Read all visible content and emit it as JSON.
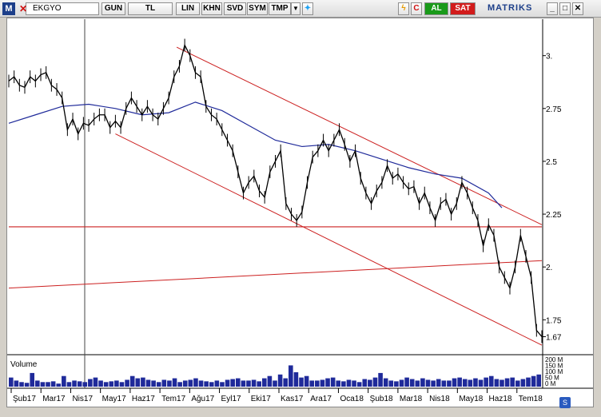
{
  "toolbar": {
    "logo": "M",
    "symbol": "EKGYO",
    "buttons": [
      "GUN",
      "TL",
      "LIN",
      "KHN",
      "SVD",
      "SYM",
      "TMP"
    ],
    "buy": "AL",
    "sell": "SAT",
    "brand": "MATRIKS",
    "colors": {
      "buy": "#1a9a1a",
      "sell": "#d21c1c",
      "brand": "#1d3f8a"
    }
  },
  "volume_panel": {
    "title": "Volume",
    "ticks": [
      "200 M",
      "150 M",
      "100 M",
      "50 M",
      "0 M"
    ]
  },
  "chart_data": {
    "type": "line",
    "title": "",
    "series_colors": {
      "price": "#000000",
      "moving_average": "#1f2a9a",
      "trendlines": "#cc2020"
    },
    "yaxis": {
      "ticks": [
        3.0,
        2.75,
        2.5,
        2.25,
        2.0,
        1.75,
        1.67
      ],
      "tick_labels": [
        "3.",
        "2.75",
        "2.5",
        "2.25",
        "2.",
        "1.75",
        "1.67"
      ],
      "ylim": [
        1.6,
        3.15
      ]
    },
    "xaxis": {
      "tick_labels": [
        "Şub17",
        "Mar17",
        "Nis17",
        "May17",
        "Haz17",
        "Tem17",
        "Ağu17",
        "Eyl17",
        "Eki17",
        "Kas17",
        "Ara17",
        "Oca18",
        "Şub18",
        "Mar18",
        "Nis18",
        "May18",
        "Haz18",
        "Tem18"
      ]
    },
    "price": {
      "name": "",
      "x": [
        0,
        2,
        4,
        6,
        8,
        10,
        12,
        14,
        16,
        18,
        20,
        22,
        24,
        26,
        28,
        30,
        32,
        34,
        36,
        38,
        40,
        42,
        44,
        46,
        48,
        50,
        52,
        54,
        56,
        58,
        60,
        62,
        64,
        66,
        68,
        70,
        72,
        74,
        76,
        78,
        80,
        82,
        84,
        86,
        88,
        90,
        92,
        94,
        96,
        98,
        100,
        102,
        104,
        106,
        108,
        110,
        112,
        114,
        116,
        118,
        120,
        122,
        124,
        126,
        128,
        130,
        132,
        134,
        136,
        138,
        140,
        142,
        144,
        146,
        148,
        150,
        152,
        154,
        156,
        158,
        160,
        162,
        164,
        166,
        168,
        170,
        172,
        174,
        176,
        178,
        180,
        182,
        184,
        186,
        188,
        190,
        192,
        194,
        196,
        198,
        200
      ],
      "values": [
        2.88,
        2.9,
        2.86,
        2.85,
        2.9,
        2.88,
        2.91,
        2.92,
        2.86,
        2.84,
        2.8,
        2.65,
        2.7,
        2.63,
        2.68,
        2.67,
        2.7,
        2.72,
        2.72,
        2.66,
        2.69,
        2.66,
        2.75,
        2.8,
        2.76,
        2.72,
        2.76,
        2.72,
        2.7,
        2.75,
        2.8,
        2.9,
        2.95,
        3.05,
        3.0,
        2.92,
        2.9,
        2.76,
        2.72,
        2.7,
        2.65,
        2.6,
        2.55,
        2.45,
        2.35,
        2.4,
        2.43,
        2.36,
        2.33,
        2.45,
        2.5,
        2.55,
        2.3,
        2.25,
        2.22,
        2.26,
        2.4,
        2.52,
        2.55,
        2.6,
        2.55,
        2.6,
        2.65,
        2.58,
        2.5,
        2.55,
        2.42,
        2.35,
        2.3,
        2.36,
        2.4,
        2.48,
        2.42,
        2.44,
        2.4,
        2.37,
        2.38,
        2.3,
        2.35,
        2.28,
        2.22,
        2.3,
        2.32,
        2.25,
        2.3,
        2.4,
        2.35,
        2.28,
        2.22,
        2.1,
        2.2,
        2.15,
        2.0,
        1.95,
        1.9,
        2.0,
        2.15,
        2.05,
        1.95,
        1.7,
        1.67
      ]
    },
    "moving_average": {
      "name": "",
      "x": [
        0,
        10,
        20,
        30,
        40,
        50,
        60,
        70,
        80,
        90,
        100,
        110,
        120,
        130,
        140,
        150,
        160,
        170,
        180,
        185
      ],
      "values": [
        2.68,
        2.72,
        2.76,
        2.77,
        2.75,
        2.72,
        2.73,
        2.78,
        2.74,
        2.67,
        2.6,
        2.57,
        2.58,
        2.55,
        2.51,
        2.47,
        2.44,
        2.42,
        2.35,
        2.28
      ]
    },
    "horizontal_support": {
      "y": 2.19
    },
    "rising_line": {
      "from": [
        0,
        1.9
      ],
      "to": [
        200,
        2.03
      ]
    },
    "channel_upper": {
      "from": [
        63,
        3.04
      ],
      "to": [
        200,
        2.2
      ]
    },
    "channel_lower": {
      "from": [
        40,
        2.63
      ],
      "to": [
        200,
        1.63
      ]
    },
    "volume": {
      "values": [
        60,
        40,
        30,
        25,
        90,
        40,
        30,
        30,
        35,
        20,
        70,
        30,
        40,
        35,
        30,
        50,
        60,
        40,
        30,
        35,
        40,
        30,
        45,
        70,
        55,
        60,
        45,
        40,
        30,
        45,
        40,
        55,
        30,
        40,
        45,
        55,
        40,
        35,
        30,
        40,
        30,
        45,
        50,
        55,
        40,
        40,
        45,
        35,
        55,
        70,
        40,
        80,
        55,
        140,
        95,
        60,
        70,
        40,
        40,
        45,
        55,
        60,
        40,
        35,
        45,
        40,
        30,
        50,
        45,
        60,
        90,
        55,
        40,
        35,
        45,
        60,
        50,
        40,
        55,
        45,
        40,
        50,
        40,
        40,
        55,
        60,
        50,
        45,
        55,
        45,
        60,
        70,
        50,
        45,
        55,
        60,
        40,
        50,
        60,
        70,
        80
      ]
    }
  }
}
